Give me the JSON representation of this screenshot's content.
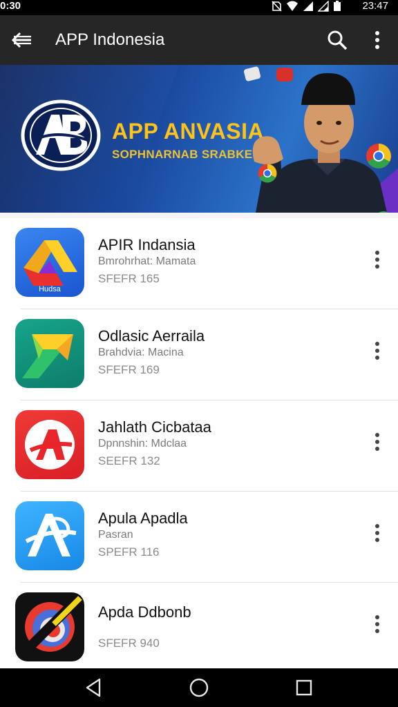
{
  "status_bar": {
    "time_left": "0:30",
    "time_right": "23:47"
  },
  "app_bar": {
    "title": "APP Indonesia",
    "back_icon": "arrow-back-icon",
    "search_icon": "search-icon",
    "overflow_icon": "more-vert-icon"
  },
  "banner": {
    "title": "APP ANVASIA",
    "subtitle": "SOPHNARNAB SRABKEN",
    "logo_text": "AB"
  },
  "apps": [
    {
      "name": "APIR Indansia",
      "publisher": "Bmrohrhat: Mamata",
      "size": "SFEFR 165",
      "icon_label": "Hudsa",
      "colors": [
        "#1f6fe0",
        "#5b9cf2"
      ]
    },
    {
      "name": "Odlasic Aerraila",
      "publisher": "Brahdvia: Macina",
      "size": "SFEFR 169",
      "colors": [
        "#0f8c74",
        "#17b08c"
      ]
    },
    {
      "name": "Jahlath Cicbataa",
      "publisher": "Dpnnshin: Mdclaa",
      "size": "SEEFR 132",
      "colors": [
        "#e52d2d",
        "#ff4a3d"
      ]
    },
    {
      "name": "Apula Apadla",
      "publisher": "Pasran",
      "size": "SPEFR 116",
      "colors": [
        "#1e9cf0",
        "#3fb6ff"
      ]
    },
    {
      "name": "Apda Ddbonb",
      "publisher": "",
      "size": "SFEFR 940",
      "colors": [
        "#111111",
        "#222222"
      ]
    }
  ],
  "nav_bar": {
    "back": "nav-back-icon",
    "home": "nav-home-icon",
    "recents": "nav-recents-icon"
  }
}
